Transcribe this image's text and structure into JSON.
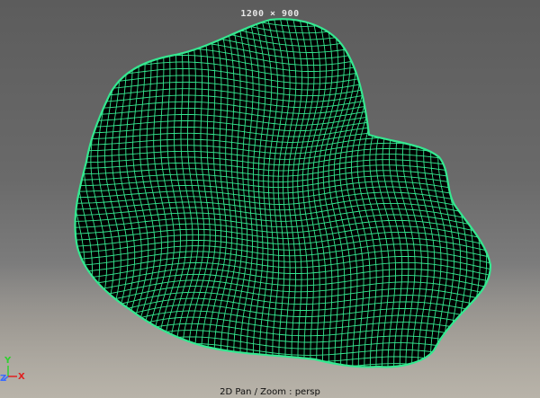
{
  "viewport": {
    "resolution_label": "1200 × 900",
    "camera_label": "2D Pan / Zoom : persp",
    "wire_color": "#34e890",
    "mesh_fill": "#000000"
  },
  "axis": {
    "y_label": "Y",
    "z_label": "Z",
    "x_label": "X",
    "y_color": "#2fd12f",
    "z_color": "#3a6bff",
    "x_color": "#e02020"
  }
}
